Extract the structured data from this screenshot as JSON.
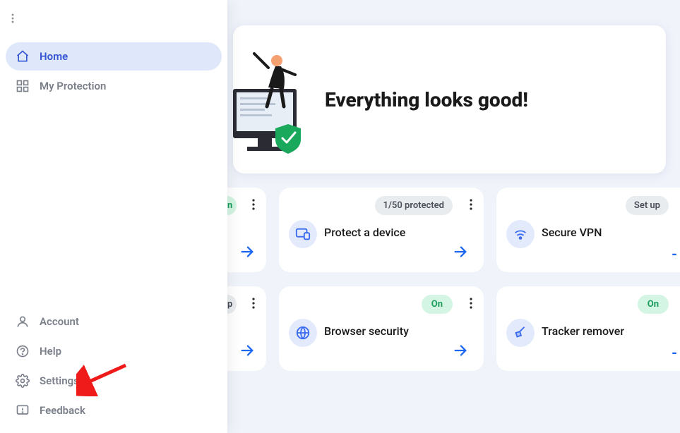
{
  "sidebar": {
    "nav_top": [
      {
        "label": "Home",
        "icon": "home-icon",
        "active": true
      },
      {
        "label": "My Protection",
        "icon": "protection-icon",
        "active": false
      }
    ],
    "nav_bottom": [
      {
        "label": "Account",
        "icon": "account-icon"
      },
      {
        "label": "Help",
        "icon": "help-icon"
      },
      {
        "label": "Settings",
        "icon": "settings-icon"
      },
      {
        "label": "Feedback",
        "icon": "feedback-icon"
      }
    ]
  },
  "banner": {
    "title": "Everything looks good!"
  },
  "cards_row1": {
    "partial_left": {
      "badge_text": "n",
      "show_arrow": true
    },
    "card_center": {
      "badge": "1/50 protected",
      "title": "Protect a device",
      "icon": "device-icon"
    },
    "card_right": {
      "badge": "Set up",
      "title": "Secure VPN",
      "icon": "wifi-icon"
    }
  },
  "cards_row2": {
    "partial_left": {
      "badge_text": "p",
      "show_arrow": true
    },
    "card_center": {
      "badge": "On",
      "title": "Browser security",
      "icon": "globe-icon"
    },
    "card_right": {
      "badge": "On",
      "title": "Tracker remover",
      "icon": "broom-icon"
    }
  }
}
